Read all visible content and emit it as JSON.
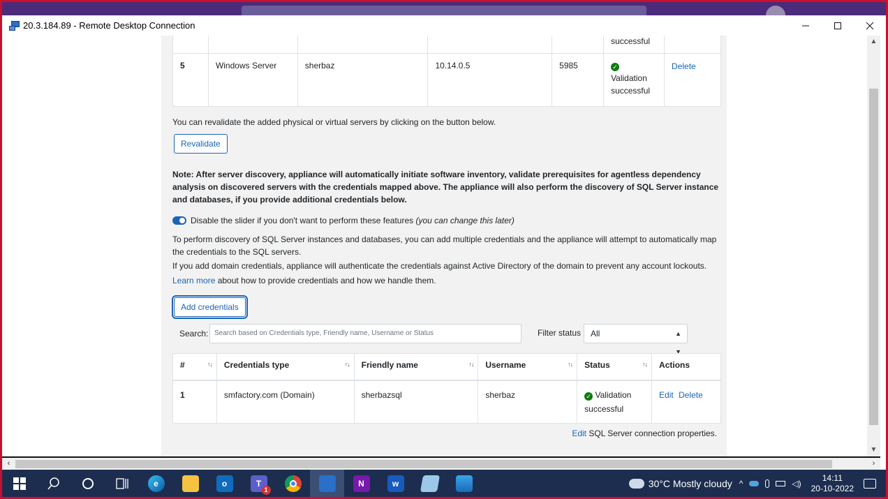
{
  "window": {
    "title": "20.3.184.89 - Remote Desktop Connection",
    "minimize": "—",
    "maximize": "☐",
    "close": "✕"
  },
  "servers_table": {
    "rows": [
      {
        "index": "",
        "os": "",
        "username": "",
        "ip": "",
        "port": "",
        "status": "successful",
        "action": ""
      },
      {
        "index": "5",
        "os": "Windows Server",
        "username": "sherbaz",
        "ip": "10.14.0.5",
        "port": "5985",
        "status_line1": "Validation",
        "status_line2": "successful",
        "action": "Delete"
      }
    ]
  },
  "revalidate": {
    "description": "You can revalidate the added physical or virtual servers by clicking on the button below.",
    "button": "Revalidate"
  },
  "note": "Note: After server discovery, appliance will automatically initiate software inventory, validate prerequisites for agentless dependency analysis on discovered servers with the credentials mapped above. The appliance will also perform the discovery of SQL Server instance and databases, if you provide additional credentials below.",
  "slider": {
    "label": "Disable the slider if you don't want to perform these features",
    "hint": "(you can change this later)",
    "enabled": true
  },
  "sql_info": {
    "paragraph1": "To perform discovery of SQL Server instances and databases, you can add multiple credentials and the appliance will attempt to automatically map the credentials to the SQL servers.",
    "paragraph2": "If you add domain credentials, appliance will authenticate the credentials against Active Directory of the domain to prevent any account lockouts.",
    "learn_more": "Learn more",
    "learn_more_suffix": " about how to provide credentials and how we handle them."
  },
  "add_credentials_button": "Add credentials",
  "search": {
    "label": "Search:",
    "placeholder": "Search based on Credentials type, Friendly name, Username or Status",
    "value": ""
  },
  "filter": {
    "label": "Filter status",
    "selected": "All"
  },
  "credentials_table": {
    "headers": [
      "#",
      "Credentials type",
      "Friendly name",
      "Username",
      "Status",
      "Actions"
    ],
    "rows": [
      {
        "index": "1",
        "type": "smfactory.com (Domain)",
        "friendly_name": "sherbazsql",
        "username": "sherbaz",
        "status_line1": "Validation",
        "status_line2": "successful",
        "edit": "Edit",
        "delete": "Delete"
      }
    ]
  },
  "edit_connection": {
    "link": "Edit",
    "text": " SQL Server connection properties."
  },
  "taskbar": {
    "weather_temp": "30°C",
    "weather_text": "Mostly cloudy",
    "time": "14:11",
    "date": "20-10-2022",
    "teams_badge": "1"
  },
  "colors": {
    "link": "#1a64b5",
    "success": "#107c10",
    "frame": "#c8102e",
    "taskbar": "#1c2d4f"
  }
}
